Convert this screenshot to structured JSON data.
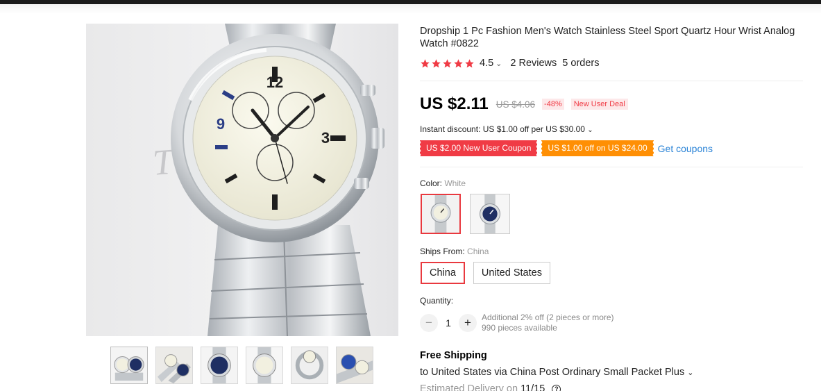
{
  "product": {
    "title": "Dropship 1 Pc Fashion Men's Watch Stainless Steel Sport Quartz Hour Wrist Analog Watch #0822",
    "rating": "4.5",
    "reviews": "2 Reviews",
    "orders": "5 orders",
    "bg_text": "Timé un"
  },
  "price": {
    "current": "US $2.11",
    "original": "US $4.06",
    "discount": "-48%",
    "deal_badge": "New User Deal",
    "instant_discount": "Instant discount: US $1.00 off per US $30.00"
  },
  "coupons": [
    {
      "label": "US $2.00 New User Coupon",
      "color": "#f03b45"
    },
    {
      "label": "US $1.00 off on US $24.00",
      "color": "#ff8f04"
    }
  ],
  "get_coupons": "Get coupons",
  "color": {
    "label": "Color:",
    "selected": "White",
    "options": [
      {
        "name": "white-watch",
        "dial": "#f2f0e0"
      },
      {
        "name": "blue-watch",
        "dial": "#1f2f63"
      }
    ]
  },
  "ships_from": {
    "label": "Ships From:",
    "selected": "China",
    "options": [
      "China",
      "United States"
    ]
  },
  "quantity": {
    "label": "Quantity:",
    "value": "1",
    "minus": "−",
    "plus": "+",
    "promo": "Additional 2% off (2 pieces or more)",
    "available": "990 pieces available"
  },
  "shipping": {
    "free": "Free Shipping",
    "method": "to United States via China Post Ordinary Small Packet Plus",
    "delivery_label": "Estimated Delivery on",
    "delivery_date": "11/15",
    "help_glyph": "?"
  },
  "icons": {
    "star": "star-icon",
    "chevron": "chevron-down-icon",
    "help": "question-circle-icon"
  },
  "colors": {
    "accent": "#e9393f",
    "link": "#2a83d6",
    "star": "#f03b45"
  }
}
